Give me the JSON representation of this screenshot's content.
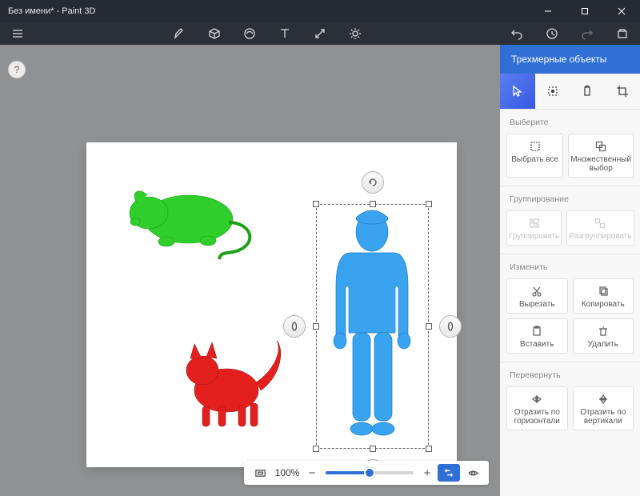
{
  "title": "Без имени* - Paint 3D",
  "panel": {
    "header": "Трехмерные объекты",
    "sections": {
      "select": {
        "label": "Выберите",
        "selectAll": "Выбрать все",
        "multi": "Множественный выбор"
      },
      "group": {
        "label": "Группирование",
        "group": "Группировать",
        "ungroup": "Разгруппировать"
      },
      "edit": {
        "label": "Изменить",
        "cut": "Вырезать",
        "copy": "Копировать",
        "paste": "Вставить",
        "delete": "Удалить"
      },
      "flip": {
        "label": "Перевернуть",
        "h": "Отразить по горизонтали",
        "v": "Отразить по вертикали"
      }
    }
  },
  "zoom": {
    "value": "100%"
  },
  "objects": {
    "mouse": "#2fce2b",
    "cat": "#e3201e",
    "man": "#39a3ef"
  }
}
